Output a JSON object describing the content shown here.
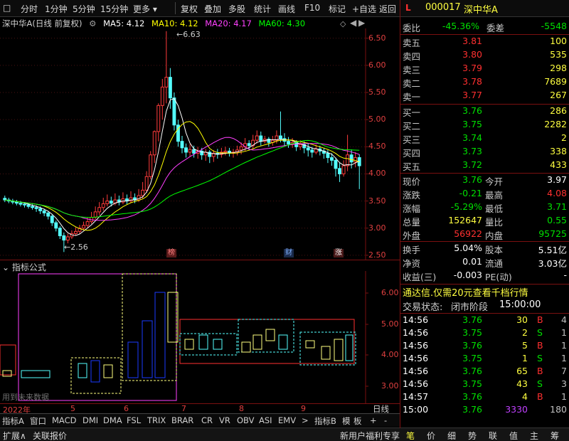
{
  "topbar": {
    "lock": "L",
    "items": [
      "分时",
      "1分钟",
      "5分钟",
      "15分钟",
      "更多",
      "复权",
      "叠加",
      "多股",
      "统计",
      "画线",
      "F10",
      "标记",
      "+自选",
      "返回"
    ]
  },
  "stock": {
    "code": "000017",
    "name": "深中华A"
  },
  "chart_header": {
    "title": "深中华A(日线 前复权)",
    "ma5": "MA5: 4.12",
    "ma10": "MA10: 4.12",
    "ma20": "MA20: 4.17",
    "ma60": "MA60: 4.30",
    "colors": {
      "ma5": "#ffffff",
      "ma10": "#ffff00",
      "ma20": "#ff40ff",
      "ma60": "#00ff00"
    }
  },
  "chart_data": {
    "type": "candlestick",
    "y_ticks": [
      "6.50",
      "6.00",
      "5.50",
      "5.00",
      "4.50",
      "4.00",
      "3.50",
      "3.00",
      "2.50"
    ],
    "ylim": [
      2.42,
      6.68
    ],
    "high_label": "6.63",
    "low_label": "2.56",
    "event_markers": [
      "榜",
      "财",
      "涨"
    ],
    "x_ticks": [
      "2022年",
      "5",
      "6",
      "7",
      "8",
      "9"
    ],
    "candles": [
      [
        3.55,
        3.52,
        3.6,
        3.48
      ],
      [
        3.52,
        3.5,
        3.56,
        3.46
      ],
      [
        3.5,
        3.48,
        3.54,
        3.44
      ],
      [
        3.48,
        3.46,
        3.52,
        3.42
      ],
      [
        3.46,
        3.44,
        3.5,
        3.4
      ],
      [
        3.44,
        3.43,
        3.48,
        3.38
      ],
      [
        3.43,
        3.4,
        3.46,
        3.36
      ],
      [
        3.4,
        3.38,
        3.44,
        3.34
      ],
      [
        3.38,
        3.36,
        3.42,
        3.3
      ],
      [
        3.36,
        3.32,
        3.4,
        3.26
      ],
      [
        3.32,
        3.28,
        3.36,
        3.22
      ],
      [
        3.28,
        3.22,
        3.31,
        3.16
      ],
      [
        3.22,
        3.1,
        3.25,
        3.04
      ],
      [
        3.1,
        3.0,
        3.14,
        2.94
      ],
      [
        3.0,
        2.86,
        3.04,
        2.8
      ],
      [
        2.86,
        2.78,
        2.92,
        2.56
      ],
      [
        2.78,
        2.84,
        2.9,
        2.72
      ],
      [
        2.84,
        2.9,
        2.96,
        2.8
      ],
      [
        2.9,
        2.94,
        3.02,
        2.86
      ],
      [
        2.94,
        3.0,
        3.06,
        2.9
      ],
      [
        3.0,
        3.05,
        3.12,
        2.96
      ],
      [
        3.05,
        3.12,
        3.2,
        3.0
      ],
      [
        3.12,
        3.2,
        3.3,
        3.08
      ],
      [
        3.2,
        3.3,
        3.4,
        3.16
      ],
      [
        3.3,
        3.38,
        3.48,
        3.24
      ],
      [
        3.38,
        3.45,
        3.56,
        3.32
      ],
      [
        3.45,
        3.5,
        3.62,
        3.4
      ],
      [
        3.5,
        3.46,
        3.58,
        3.4
      ],
      [
        3.46,
        3.52,
        3.64,
        3.42
      ],
      [
        3.52,
        3.48,
        3.6,
        3.42
      ],
      [
        3.48,
        3.54,
        3.66,
        3.44
      ],
      [
        3.54,
        3.5,
        3.62,
        3.44
      ],
      [
        3.5,
        3.56,
        3.68,
        3.46
      ],
      [
        3.56,
        3.52,
        3.64,
        3.46
      ],
      [
        3.52,
        3.6,
        3.72,
        3.48
      ],
      [
        3.6,
        3.7,
        3.85,
        3.55
      ],
      [
        3.7,
        3.95,
        4.05,
        3.65
      ],
      [
        3.95,
        4.35,
        4.42,
        3.9
      ],
      [
        4.35,
        4.78,
        4.8,
        4.2
      ],
      [
        4.78,
        5.26,
        5.3,
        4.6
      ],
      [
        5.26,
        5.6,
        5.75,
        5.0
      ],
      [
        5.6,
        5.78,
        6.63,
        5.3
      ],
      [
        5.78,
        5.4,
        5.95,
        5.2
      ],
      [
        5.4,
        4.9,
        5.5,
        4.8
      ],
      [
        4.9,
        4.6,
        5.0,
        4.5
      ],
      [
        4.6,
        4.48,
        4.7,
        4.38
      ],
      [
        4.48,
        4.4,
        4.56,
        4.3
      ],
      [
        4.4,
        4.45,
        4.55,
        4.32
      ],
      [
        4.45,
        4.38,
        4.52,
        4.3
      ],
      [
        4.38,
        4.42,
        4.5,
        4.28
      ],
      [
        4.42,
        4.35,
        4.48,
        4.26
      ],
      [
        4.35,
        4.4,
        4.46,
        4.24
      ],
      [
        4.4,
        4.32,
        4.44,
        4.2
      ],
      [
        4.32,
        4.38,
        4.44,
        4.22
      ],
      [
        4.38,
        4.36,
        4.46,
        4.28
      ],
      [
        4.36,
        4.4,
        4.48,
        4.3
      ],
      [
        4.4,
        4.42,
        4.5,
        4.34
      ],
      [
        4.42,
        4.38,
        4.48,
        4.32
      ],
      [
        4.38,
        4.4,
        4.46,
        4.3
      ],
      [
        4.4,
        4.44,
        4.52,
        4.34
      ],
      [
        4.44,
        4.5,
        4.58,
        4.36
      ],
      [
        4.5,
        4.56,
        4.66,
        4.42
      ],
      [
        4.56,
        4.52,
        4.62,
        4.44
      ],
      [
        4.52,
        4.62,
        4.72,
        4.46
      ],
      [
        4.62,
        4.7,
        4.8,
        4.56
      ],
      [
        4.7,
        4.6,
        4.78,
        4.52
      ],
      [
        4.6,
        4.64,
        4.7,
        4.56
      ],
      [
        4.64,
        4.58,
        4.68,
        4.5
      ],
      [
        4.58,
        4.62,
        4.7,
        4.52
      ],
      [
        4.62,
        4.7,
        4.8,
        4.56
      ],
      [
        4.7,
        4.65,
        5.15,
        4.58
      ],
      [
        4.65,
        4.6,
        4.75,
        4.52
      ],
      [
        4.6,
        4.55,
        4.68,
        4.48
      ],
      [
        4.55,
        4.58,
        4.66,
        4.48
      ],
      [
        4.58,
        4.5,
        4.62,
        4.42
      ],
      [
        4.5,
        4.54,
        4.62,
        4.44
      ],
      [
        4.54,
        4.48,
        4.6,
        4.38
      ],
      [
        4.48,
        4.44,
        4.56,
        4.32
      ],
      [
        4.44,
        4.4,
        4.5,
        4.3
      ],
      [
        4.4,
        4.46,
        4.54,
        4.36
      ],
      [
        4.46,
        4.42,
        4.52,
        4.34
      ],
      [
        4.42,
        4.38,
        4.48,
        4.28
      ],
      [
        4.38,
        4.3,
        4.44,
        4.2
      ],
      [
        4.3,
        4.25,
        4.38,
        4.15
      ],
      [
        4.25,
        4.1,
        4.3,
        3.95
      ],
      [
        4.1,
        4.0,
        4.2,
        3.85
      ],
      [
        4.0,
        4.15,
        4.25,
        3.95
      ],
      [
        4.15,
        4.35,
        4.72,
        4.05
      ],
      [
        4.35,
        4.22,
        4.45,
        4.1
      ],
      [
        4.22,
        4.3,
        4.4,
        4.12
      ],
      [
        4.3,
        4.15,
        4.36,
        3.72
      ]
    ]
  },
  "indicator": {
    "label": "指标公式",
    "y_ticks": [
      "6.00",
      "5.00",
      "4.00",
      "3.00"
    ],
    "warning": "用到未来数据"
  },
  "bottom_tabs": [
    "指标A",
    "窗口",
    "MACD",
    "DMI",
    "DMA",
    "FSL",
    "TRIX",
    "BRAR",
    "CR",
    "VR",
    "OBV",
    "ASI",
    "EMV",
    ">",
    "指标B",
    "模",
    "板",
    "+",
    "-",
    "日线"
  ],
  "status_left": [
    "扩展∧",
    "关联报价"
  ],
  "status_right": [
    "新用户福利专享",
    "笔",
    "价",
    "细",
    "势",
    "联",
    "值",
    "主",
    "筹"
  ],
  "quote": {
    "weibi": {
      "label": "委比",
      "value": "-45.36%",
      "label2": "委差",
      "value2": "-5548"
    },
    "sell": [
      {
        "label": "卖五",
        "price": "3.81",
        "vol": "100"
      },
      {
        "label": "卖四",
        "price": "3.80",
        "vol": "535"
      },
      {
        "label": "卖三",
        "price": "3.79",
        "vol": "298"
      },
      {
        "label": "卖二",
        "price": "3.78",
        "vol": "7689"
      },
      {
        "label": "卖一",
        "price": "3.77",
        "vol": "267"
      }
    ],
    "buy": [
      {
        "label": "买一",
        "price": "3.76",
        "vol": "286"
      },
      {
        "label": "买二",
        "price": "3.75",
        "vol": "2282"
      },
      {
        "label": "买三",
        "price": "3.74",
        "vol": "2"
      },
      {
        "label": "买四",
        "price": "3.73",
        "vol": "338"
      },
      {
        "label": "买五",
        "price": "3.72",
        "vol": "433"
      }
    ],
    "stats1": [
      {
        "l1": "现价",
        "v1": "3.76",
        "c1": "#00e000",
        "l2": "今开",
        "v2": "3.97",
        "c2": "#ffffff"
      },
      {
        "l1": "涨跌",
        "v1": "-0.21",
        "c1": "#00e000",
        "l2": "最高",
        "v2": "4.08",
        "c2": "#ff3030"
      },
      {
        "l1": "涨幅",
        "v1": "-5.29%",
        "c1": "#00e000",
        "l2": "最低",
        "v2": "3.71",
        "c2": "#00e000"
      },
      {
        "l1": "总量",
        "v1": "152647",
        "c1": "#ffff40",
        "l2": "量比",
        "v2": "0.55",
        "c2": "#00e000"
      },
      {
        "l1": "外盘",
        "v1": "56922",
        "c1": "#ff3030",
        "l2": "内盘",
        "v2": "95725",
        "c2": "#00e000"
      }
    ],
    "stats2": [
      {
        "l1": "换手",
        "v1": "5.04%",
        "l2": "股本",
        "v2": "5.51亿"
      },
      {
        "l1": "净资",
        "v1": "0.01",
        "l2": "流通",
        "v2": "3.03亿"
      },
      {
        "l1": "收益(三)",
        "v1": "-0.003",
        "l2": "PE(动)",
        "v2": "-"
      }
    ],
    "ad": "通达信.仅需20元查看千档行情",
    "trade_state_label": "交易状态:",
    "trade_state": "闭市阶段",
    "trade_time": "15:00:00",
    "ticks": [
      {
        "t": "14:56",
        "p": "3.76",
        "v": "30",
        "s": "B",
        "n": "4"
      },
      {
        "t": "14:56",
        "p": "3.75",
        "v": "2",
        "s": "S",
        "n": "1"
      },
      {
        "t": "14:56",
        "p": "3.76",
        "v": "5",
        "s": "B",
        "n": "1"
      },
      {
        "t": "14:56",
        "p": "3.75",
        "v": "1",
        "s": "S",
        "n": "1"
      },
      {
        "t": "14:56",
        "p": "3.76",
        "v": "65",
        "s": "B",
        "n": "7"
      },
      {
        "t": "14:56",
        "p": "3.75",
        "v": "43",
        "s": "S",
        "n": "3"
      },
      {
        "t": "14:57",
        "p": "3.76",
        "v": "4",
        "s": "B",
        "n": "1"
      },
      {
        "t": "15:00",
        "p": "3.76",
        "v": "3330",
        "s": "",
        "n": "180"
      }
    ]
  }
}
